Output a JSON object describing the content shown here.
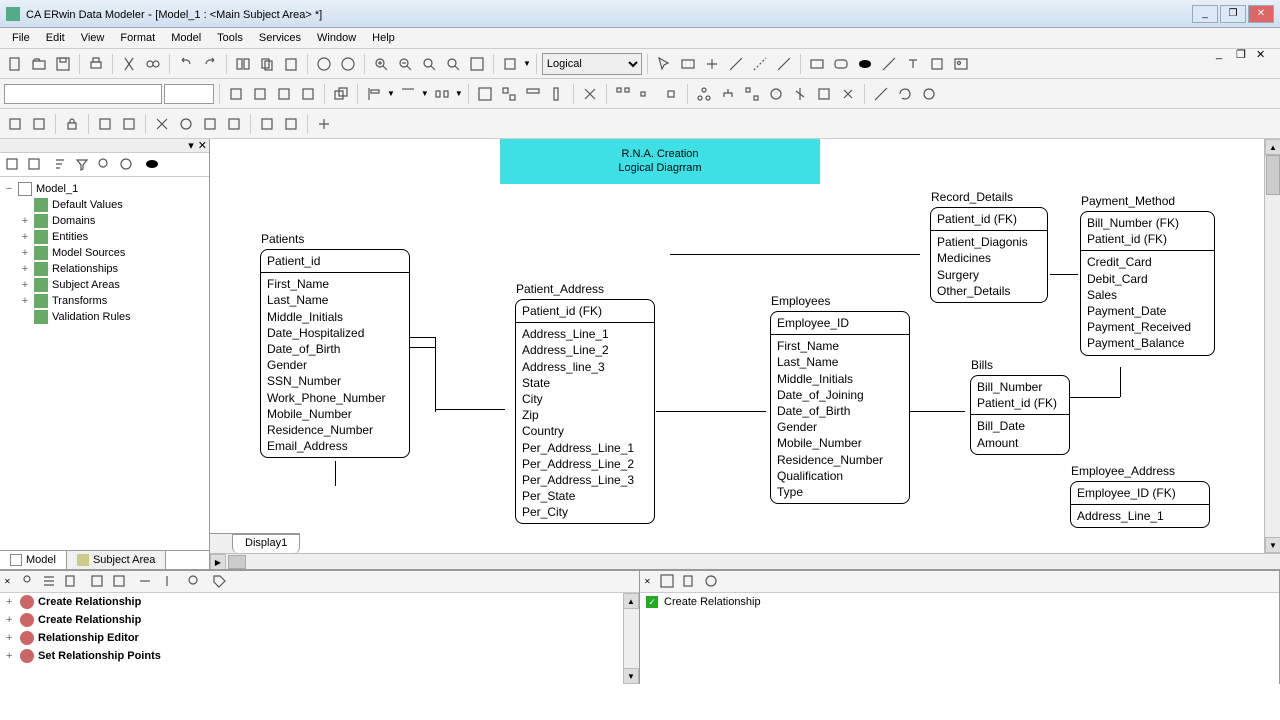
{
  "window": {
    "app": "CA ERwin Data Modeler",
    "doc": "[Model_1 : <Main Subject Area> *]"
  },
  "menu": [
    "File",
    "Edit",
    "View",
    "Format",
    "Model",
    "Tools",
    "Services",
    "Window",
    "Help"
  ],
  "toolbar1_dropdown": "Logical",
  "tree": {
    "root": "Model_1",
    "items": [
      "Default Values",
      "Domains",
      "Entities",
      "Model Sources",
      "Relationships",
      "Subject Areas",
      "Transforms",
      "Validation Rules"
    ]
  },
  "sidebar_tabs": {
    "model": "Model",
    "subject": "Subject Area"
  },
  "display_tab": "Display1",
  "diagram_title": {
    "line1": "R.N.A. Creation",
    "line2": "Logical Diagrram"
  },
  "entities": {
    "patients": {
      "name": "Patients",
      "pk": [
        "Patient_id"
      ],
      "attrs": [
        "First_Name",
        "Last_Name",
        "Middle_Initials",
        "Date_Hospitalized",
        "Date_of_Birth",
        "Gender",
        "SSN_Number",
        "Work_Phone_Number",
        "Mobile_Number",
        "Residence_Number",
        "Email_Address"
      ]
    },
    "patient_address": {
      "name": "Patient_Address",
      "pk": [
        "Patient_id (FK)"
      ],
      "attrs": [
        "Address_Line_1",
        "Address_Line_2",
        "Address_line_3",
        "State",
        "City",
        "Zip",
        "Country",
        "Per_Address_Line_1",
        "Per_Address_Line_2",
        "Per_Address_Line_3",
        "Per_State",
        "Per_City"
      ]
    },
    "employees": {
      "name": "Employees",
      "pk": [
        "Employee_ID"
      ],
      "attrs": [
        "First_Name",
        "Last_Name",
        "Middle_Initials",
        "Date_of_Joining",
        "Date_of_Birth",
        "Gender",
        "Mobile_Number",
        "Residence_Number",
        "Qualification",
        "Type"
      ]
    },
    "record_details": {
      "name": "Record_Details",
      "pk": [
        "Patient_id (FK)"
      ],
      "attrs": [
        "Patient_Diagonis",
        "Medicines",
        "Surgery",
        "Other_Details"
      ]
    },
    "bills": {
      "name": "Bills",
      "pk": [
        "Bill_Number",
        "Patient_id (FK)"
      ],
      "attrs": [
        "Bill_Date",
        "Amount"
      ]
    },
    "payment_method": {
      "name": "Payment_Method",
      "pk": [
        "Bill_Number (FK)",
        "Patient_id (FK)"
      ],
      "attrs": [
        "Credit_Card",
        "Debit_Card",
        "Sales",
        "Payment_Date",
        "Payment_Received",
        "Payment_Balance"
      ]
    },
    "employee_address": {
      "name": "Employee_Address",
      "pk": [
        "Employee_ID (FK)"
      ],
      "attrs": [
        "Address_Line_1"
      ]
    }
  },
  "left_panel": {
    "items": [
      "Create Relationship",
      "Create Relationship",
      "Relationship Editor",
      "Set Relationship Points"
    ]
  },
  "right_panel": {
    "item": "Create Relationship"
  }
}
